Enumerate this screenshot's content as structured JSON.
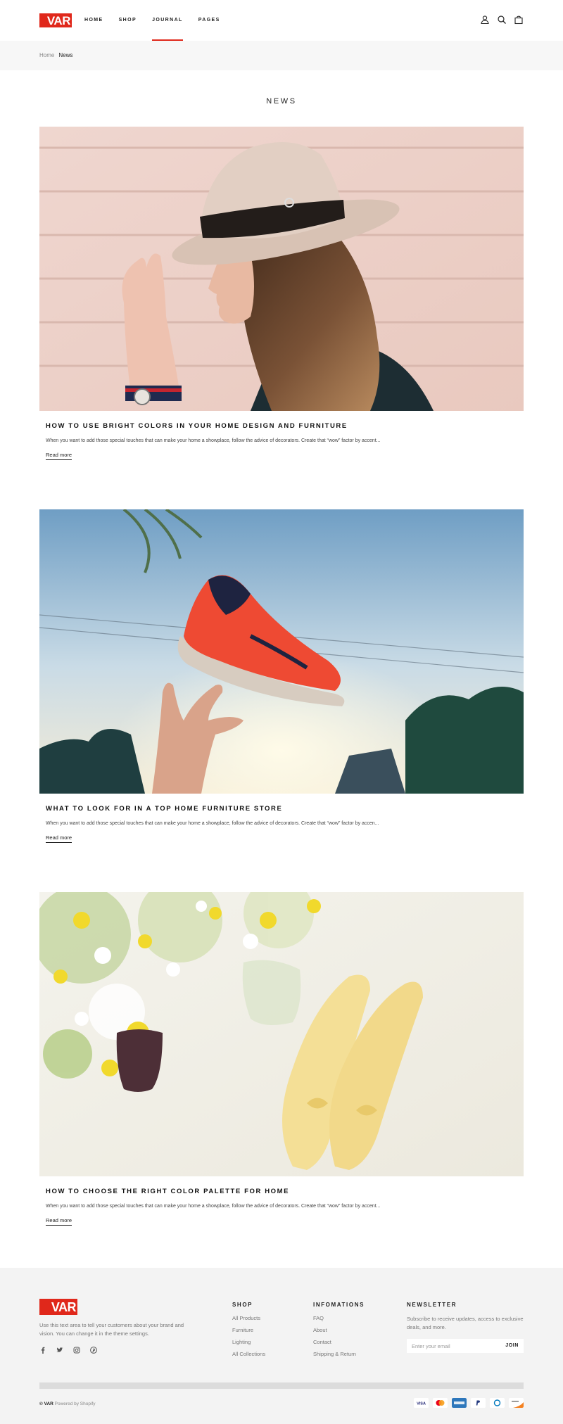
{
  "brand": {
    "logo_text": "VAR",
    "accent": "#e0281b"
  },
  "nav": {
    "items": [
      {
        "label": "HOME"
      },
      {
        "label": "SHOP"
      },
      {
        "label": "JOURNAL"
      },
      {
        "label": "PAGES"
      }
    ],
    "active": "JOURNAL",
    "icons": [
      "user-icon",
      "search-icon",
      "bag-icon"
    ]
  },
  "breadcrumb": {
    "home": "Home",
    "current": "News"
  },
  "page": {
    "title": "NEWS"
  },
  "articles": [
    {
      "title": "HOW TO USE BRIGHT COLORS IN YOUR HOME DESIGN AND FURNITURE",
      "excerpt": "When you want to add those special touches that can make your home a showplace, follow the advice of decorators. Create that “wow” factor by accent...",
      "read_more": "Read more",
      "image": "woman-with-hat-photo"
    },
    {
      "title": "WHAT TO LOOK FOR IN A TOP HOME FURNITURE STORE",
      "excerpt": "When you want to add those special touches that can make your home a showplace, follow the advice of decorators. Create that “wow” factor by accen...",
      "read_more": "Read more",
      "image": "floating-sneaker-photo"
    },
    {
      "title": "HOW TO CHOOSE THE RIGHT COLOR PALETTE FOR HOME",
      "excerpt": "When you want to add those special touches that can make your home a showplace, follow the advice of decorators. Create that “wow” factor by accent...",
      "read_more": "Read more",
      "image": "flowers-and-shoes-photo"
    }
  ],
  "footer": {
    "logo_text": "VAR",
    "description": "Use this text area to tell your customers about your brand and vision. You can change it in the theme settings.",
    "social": [
      "facebook-icon",
      "twitter-icon",
      "instagram-icon",
      "pinterest-icon"
    ],
    "shop": {
      "heading": "SHOP",
      "links": [
        "All Products",
        "Furniture",
        "Lighting",
        "All Collections"
      ]
    },
    "info": {
      "heading": "INFOMATIONS",
      "links": [
        "FAQ",
        "About",
        "Contact",
        "Shipping & Return"
      ]
    },
    "newsletter": {
      "heading": "NEWSLETTER",
      "text": "Subscribe to receive updates, access to exclusive deals, and more.",
      "placeholder": "Enter your email",
      "button": "JOIN"
    },
    "copyright_brand": "© VAR",
    "powered": "Powered by Shopify",
    "payments": [
      "visa-icon",
      "mastercard-icon",
      "amex-icon",
      "paypal-icon",
      "diners-icon",
      "discover-icon"
    ]
  }
}
